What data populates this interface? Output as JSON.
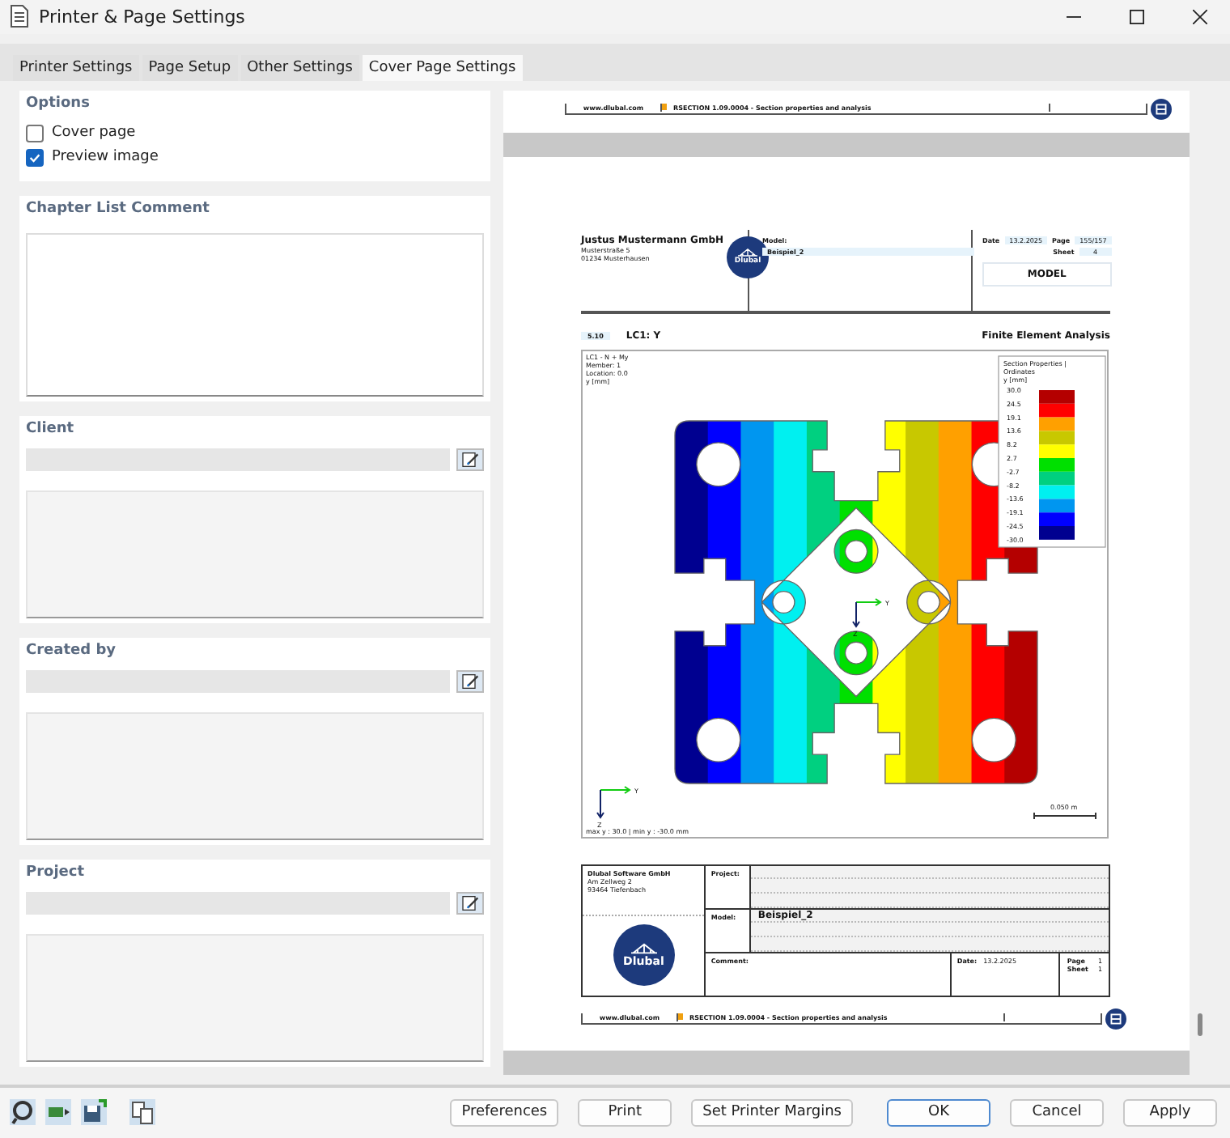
{
  "window": {
    "title": "Printer & Page Settings"
  },
  "tabs": [
    {
      "label": "Printer Settings",
      "selected": false
    },
    {
      "label": "Page Setup",
      "selected": false
    },
    {
      "label": "Other Settings",
      "selected": false
    },
    {
      "label": "Cover Page Settings",
      "selected": true
    }
  ],
  "options": {
    "title": "Options",
    "checkboxes": [
      {
        "label": "Cover page",
        "checked": false
      },
      {
        "label": "Preview image",
        "checked": true
      }
    ]
  },
  "chapter_list_comment": {
    "title": "Chapter List Comment"
  },
  "sections": [
    {
      "title": "Client"
    },
    {
      "title": "Created by"
    },
    {
      "title": "Project"
    }
  ],
  "preview": {
    "top_footer": {
      "website": "www.dlubal.com",
      "program": "RSECTION 1.09.0004 - Section properties and analysis"
    },
    "header": {
      "company": "Justus Mustermann GmbH",
      "address": [
        "Musterstraße 5",
        "01234 Musterhausen"
      ],
      "logo": "Dlubal",
      "model_label": "Model:",
      "model": "Beispiel_2",
      "date_label": "Date",
      "date": "13.2.2025",
      "page_label": "Page",
      "page": "155/157",
      "sheet_label": "Sheet",
      "sheet": "4",
      "section_title": "MODEL"
    },
    "chapter": {
      "number": "5.10",
      "title": "LC1: Y",
      "right": "Finite Element Analysis"
    },
    "figure": {
      "info": [
        "LC1 - N + My",
        "Member: 1",
        "Location: 0.0",
        "y [mm]"
      ],
      "legend_title": [
        "Section Properties |",
        "Ordinates",
        "y [mm]"
      ],
      "legend_values": [
        "30.0",
        "24.5",
        "19.1",
        "13.6",
        "8.2",
        "2.7",
        "-2.7",
        "-8.2",
        "-13.6",
        "-19.1",
        "-24.5",
        "-30.0"
      ],
      "bands": [
        {
          "color": "#b40000"
        },
        {
          "color": "#ff0000"
        },
        {
          "color": "#ffa000"
        },
        {
          "color": "#c8c800"
        },
        {
          "color": "#ffff00"
        },
        {
          "color": "#00e000"
        },
        {
          "color": "#00d080"
        },
        {
          "color": "#00f0f0"
        },
        {
          "color": "#0096f0"
        },
        {
          "color": "#0000ff"
        },
        {
          "color": "#000090"
        }
      ],
      "axes": [
        {
          "y": "Y",
          "z": "Z"
        },
        {
          "y": "Y",
          "z": "Z"
        }
      ],
      "scale": "0.050 m",
      "minmax": "max y : 30.0 | min y : -30.0 mm"
    },
    "title_block": {
      "company": "Dlubal Software GmbH",
      "address": [
        "Am Zellweg 2",
        "93464 Tiefenbach"
      ],
      "logo": "Dlubal",
      "project_label": "Project:",
      "model_label": "Model:",
      "model": "Beispiel_2",
      "comment_label": "Comment:",
      "date_label": "Date:",
      "date": "13.2.2025",
      "page_label": "Page",
      "page": "1",
      "sheet_label": "Sheet",
      "sheet": "1"
    },
    "bottom_footer": {
      "website": "www.dlubal.com",
      "program": "RSECTION 1.09.0004 - Section properties and analysis"
    }
  },
  "buttons": [
    {
      "label": "Preferences",
      "kind": "normal"
    },
    {
      "label": "Print",
      "kind": "normal"
    },
    {
      "label": "Set Printer Margins",
      "kind": "normal"
    },
    {
      "label": "OK",
      "kind": "default"
    },
    {
      "label": "Cancel",
      "kind": "normal"
    },
    {
      "label": "Apply",
      "kind": "normal"
    }
  ]
}
